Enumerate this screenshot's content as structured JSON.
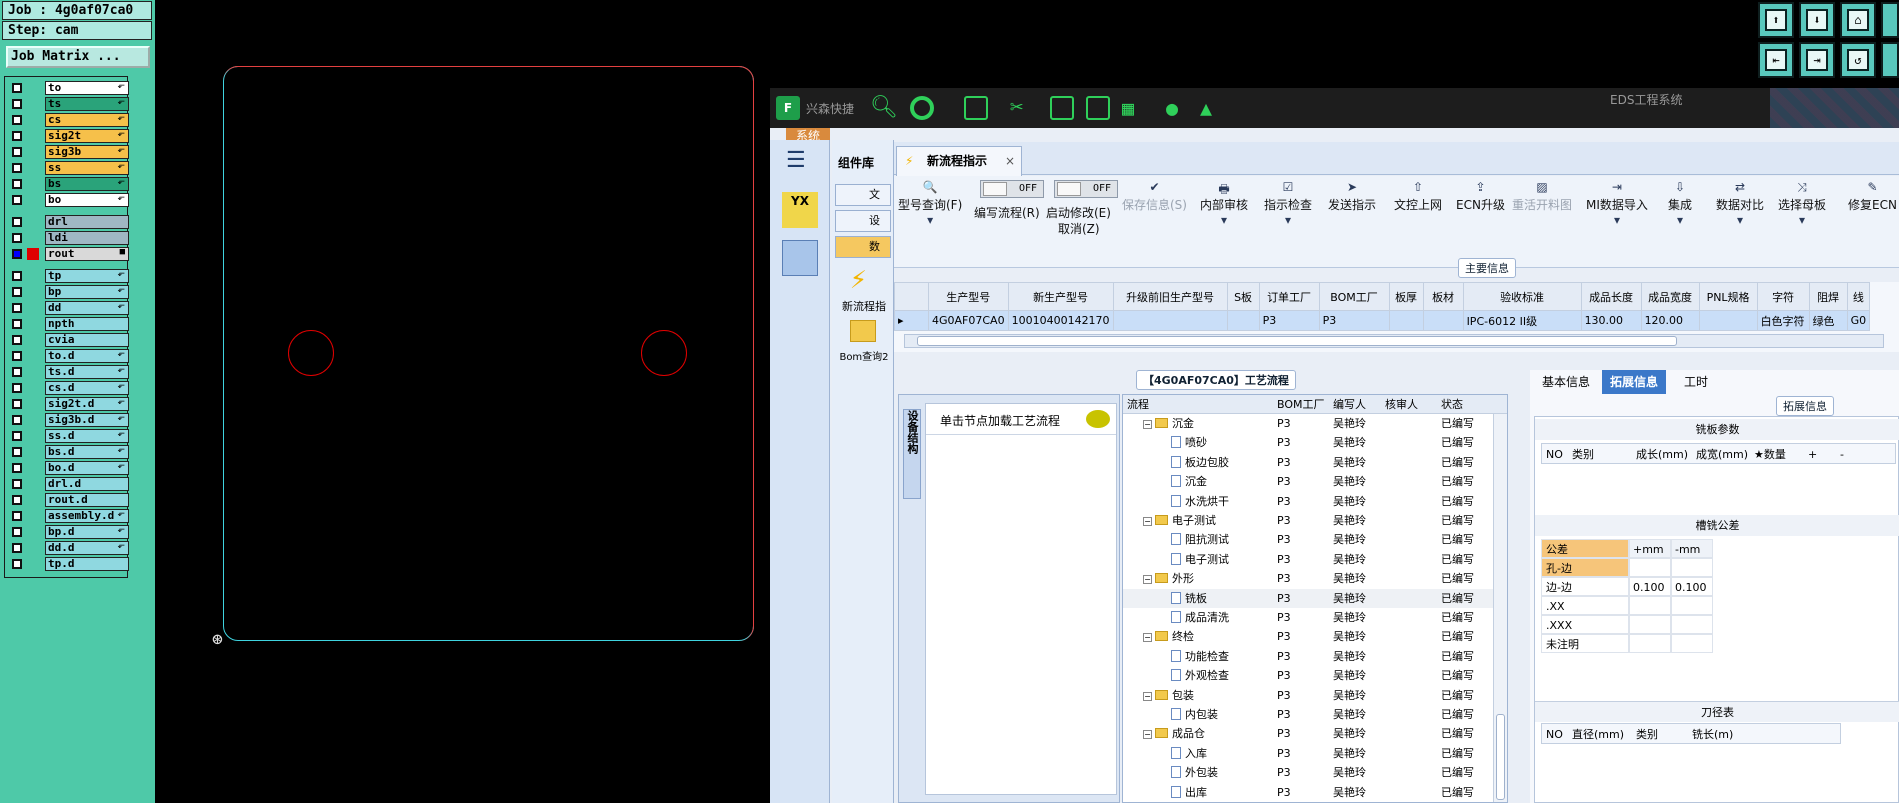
{
  "left_panel": {
    "job": "Job : 4g0af07ca0",
    "step": "Step: cam",
    "job_matrix_button": "Job Matrix ...",
    "layers": [
      {
        "name": "to",
        "color": "#ffffff",
        "mark": "⬐"
      },
      {
        "name": "ts",
        "color": "#2aa37a",
        "mark": "⬐"
      },
      {
        "name": "cs",
        "color": "#f6c04a",
        "mark": "⬐"
      },
      {
        "name": "sig2t",
        "color": "#f6c04a",
        "mark": "⬐"
      },
      {
        "name": "sig3b",
        "color": "#f6c04a",
        "mark": "⬐"
      },
      {
        "name": "ss",
        "color": "#f6c04a",
        "mark": "⬐"
      },
      {
        "name": "bs",
        "color": "#2aa37a",
        "mark": "⬐"
      },
      {
        "name": "bo",
        "color": "#ffffff",
        "mark": "⬐"
      },
      {
        "name": "drl",
        "color": "#9fb7c4",
        "mark": ""
      },
      {
        "name": "ldi",
        "color": "#9fb7c4",
        "mark": ""
      },
      {
        "name": "rout",
        "color": "#d9d9d9",
        "mark": "■"
      },
      {
        "name": "tp",
        "color": "#8fd8e0",
        "mark": "⬐"
      },
      {
        "name": "bp",
        "color": "#8fd8e0",
        "mark": "⬐"
      },
      {
        "name": "dd",
        "color": "#8fd8e0",
        "mark": "⬐"
      },
      {
        "name": "npth",
        "color": "#8fd8e0",
        "mark": ""
      },
      {
        "name": "cvia",
        "color": "#8fd8e0",
        "mark": ""
      },
      {
        "name": "to.d",
        "color": "#8fd8e0",
        "mark": "⬐"
      },
      {
        "name": "ts.d",
        "color": "#8fd8e0",
        "mark": "⬐"
      },
      {
        "name": "cs.d",
        "color": "#8fd8e0",
        "mark": "⬐"
      },
      {
        "name": "sig2t.d",
        "color": "#8fd8e0",
        "mark": "⬐"
      },
      {
        "name": "sig3b.d",
        "color": "#8fd8e0",
        "mark": "⬐"
      },
      {
        "name": "ss.d",
        "color": "#8fd8e0",
        "mark": "⬐"
      },
      {
        "name": "bs.d",
        "color": "#8fd8e0",
        "mark": "⬐"
      },
      {
        "name": "bo.d",
        "color": "#8fd8e0",
        "mark": "⬐"
      },
      {
        "name": "drl.d",
        "color": "#8fd8e0",
        "mark": ""
      },
      {
        "name": "rout.d",
        "color": "#8fd8e0",
        "mark": ""
      },
      {
        "name": "assembly.d",
        "color": "#8fd8e0",
        "mark": "⬐"
      },
      {
        "name": "bp.d",
        "color": "#8fd8e0",
        "mark": "⬐"
      },
      {
        "name": "dd.d",
        "color": "#8fd8e0",
        "mark": "⬐"
      },
      {
        "name": "tp.d",
        "color": "#8fd8e0",
        "mark": ""
      }
    ]
  },
  "eds": {
    "title": "EDS工程系统",
    "logo_text": "兴森快捷",
    "system_tab": "系统",
    "component_lib": "组件库",
    "comp_items": [
      "文",
      "设",
      "数"
    ],
    "new_flow_label": "新流程指",
    "bom_query": "Bom查询2",
    "active_tab": "新流程指示",
    "ribbon": [
      {
        "glyph": "🔍",
        "label": "型号查询(F)",
        "disabled": false
      },
      {
        "glyph": "",
        "label": "编写流程(R)",
        "disabled": false
      },
      {
        "glyph": "",
        "label": "启动修改(E)",
        "disabled": false
      },
      {
        "glyph": "",
        "label": "取消(Z)",
        "disabled": false
      },
      {
        "glyph": "✔",
        "label": "保存信息(S)",
        "disabled": true
      },
      {
        "glyph": "🖶",
        "label": "内部审核",
        "disabled": false
      },
      {
        "glyph": "☑",
        "label": "指示检查",
        "disabled": false
      },
      {
        "glyph": "➤",
        "label": "发送指示",
        "disabled": false
      },
      {
        "glyph": "⇧",
        "label": "文控上网",
        "disabled": false
      },
      {
        "glyph": "⇪",
        "label": "ECN升级",
        "disabled": false
      },
      {
        "glyph": "▨",
        "label": "重活开料图",
        "disabled": true
      },
      {
        "glyph": "⇥",
        "label": "MI数据导入",
        "disabled": false
      },
      {
        "glyph": "⇩",
        "label": "集成",
        "disabled": false
      },
      {
        "glyph": "⇄",
        "label": "数据对比",
        "disabled": false
      },
      {
        "glyph": "⤨",
        "label": "选择母板",
        "disabled": false
      },
      {
        "glyph": "✎",
        "label": "修复ECN",
        "disabled": false
      }
    ],
    "toggle_off": "OFF",
    "main_info_title": "主要信息",
    "grid_headers": [
      "生产型号",
      "新生产型号",
      "升级前旧生产型号",
      "S板",
      "订单工厂",
      "BOM工厂",
      "板厚",
      "板材",
      "验收标准",
      "成品长度",
      "成品宽度",
      "PNL规格",
      "字符",
      "阻焊",
      "线"
    ],
    "grid_row": [
      "4G0AF07CA0",
      "10010400142170",
      "",
      "",
      "P3",
      "P3",
      "",
      "",
      "IPC-6012 II级",
      "130.00",
      "120.00",
      "",
      "白色字符",
      "绿色",
      "G0"
    ],
    "flow_title": "【4G0AF07CA0】工艺流程",
    "side_tab": "设备结构",
    "node_hint": "单击节点加载工艺流程",
    "tree_headers": [
      "流程",
      "BOM工厂",
      "编写人",
      "核审人",
      "状态"
    ],
    "tree_rows": [
      {
        "name": "沉金",
        "level": 0,
        "factory": "P3",
        "writer": "吴艳玲",
        "status": "已编写"
      },
      {
        "name": "喷砂",
        "level": 1,
        "factory": "P3",
        "writer": "吴艳玲",
        "status": "已编写"
      },
      {
        "name": "板边包胶",
        "level": 1,
        "factory": "P3",
        "writer": "吴艳玲",
        "status": "已编写"
      },
      {
        "name": "沉金",
        "level": 1,
        "factory": "P3",
        "writer": "吴艳玲",
        "status": "已编写"
      },
      {
        "name": "水洗烘干",
        "level": 1,
        "factory": "P3",
        "writer": "吴艳玲",
        "status": "已编写"
      },
      {
        "name": "电子测试",
        "level": 0,
        "factory": "P3",
        "writer": "吴艳玲",
        "status": "已编写"
      },
      {
        "name": "阻抗测试",
        "level": 1,
        "factory": "P3",
        "writer": "吴艳玲",
        "status": "已编写"
      },
      {
        "name": "电子测试",
        "level": 1,
        "factory": "P3",
        "writer": "吴艳玲",
        "status": "已编写"
      },
      {
        "name": "外形",
        "level": 0,
        "factory": "P3",
        "writer": "吴艳玲",
        "status": "已编写"
      },
      {
        "name": "铣板",
        "level": 1,
        "factory": "P3",
        "writer": "吴艳玲",
        "status": "已编写"
      },
      {
        "name": "成品清洗",
        "level": 1,
        "factory": "P3",
        "writer": "吴艳玲",
        "status": "已编写"
      },
      {
        "name": "终检",
        "level": 0,
        "factory": "P3",
        "writer": "吴艳玲",
        "status": "已编写"
      },
      {
        "name": "功能检查",
        "level": 1,
        "factory": "P3",
        "writer": "吴艳玲",
        "status": "已编写"
      },
      {
        "name": "外观检查",
        "level": 1,
        "factory": "P3",
        "writer": "吴艳玲",
        "status": "已编写"
      },
      {
        "name": "包装",
        "level": 0,
        "factory": "P3",
        "writer": "吴艳玲",
        "status": "已编写"
      },
      {
        "name": "内包装",
        "level": 1,
        "factory": "P3",
        "writer": "吴艳玲",
        "status": "已编写"
      },
      {
        "name": "成品仓",
        "level": 0,
        "factory": "P3",
        "writer": "吴艳玲",
        "status": "已编写"
      },
      {
        "name": "入库",
        "level": 1,
        "factory": "P3",
        "writer": "吴艳玲",
        "status": "已编写"
      },
      {
        "name": "外包装",
        "level": 1,
        "factory": "P3",
        "writer": "吴艳玲",
        "status": "已编写"
      },
      {
        "name": "出库",
        "level": 1,
        "factory": "P3",
        "writer": "吴艳玲",
        "status": "已编写"
      }
    ],
    "right_tabs": [
      "基本信息",
      "拓展信息",
      "工时"
    ],
    "ext_title": "拓展信息",
    "mill_params": "铣板参数",
    "mill_headers": [
      "NO",
      "类别",
      "成长(mm)",
      "成宽(mm)",
      "★数量",
      "+",
      "-"
    ],
    "slot_tol": "槽铣公差",
    "tol_rows": [
      {
        "name": "公差",
        "plus": "+mm",
        "minus": "-mm",
        "hl": true
      },
      {
        "name": "孔-边",
        "plus": "",
        "minus": "",
        "hl": true
      },
      {
        "name": "边-边",
        "plus": "0.100",
        "minus": "0.100",
        "hl": false
      },
      {
        "name": ".XX",
        "plus": "",
        "minus": "",
        "hl": false
      },
      {
        "name": ".XXX",
        "plus": "",
        "minus": "",
        "hl": false
      },
      {
        "name": "未注明",
        "plus": "",
        "minus": "",
        "hl": false
      }
    ],
    "tool_table": "刀径表",
    "tool_headers": [
      "NO",
      "直径(mm)",
      "类别",
      "铣长(m)"
    ]
  }
}
